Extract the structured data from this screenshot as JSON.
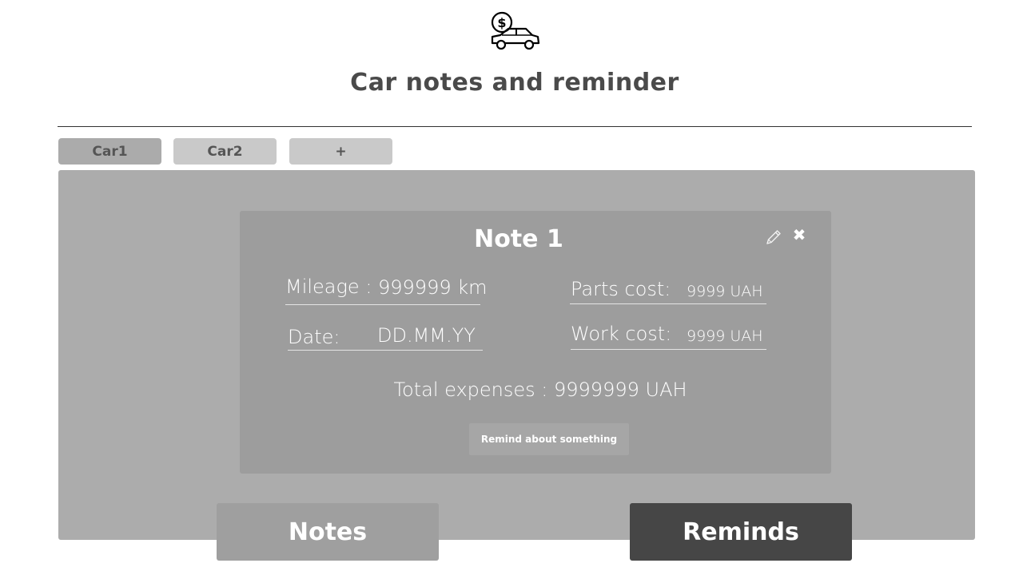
{
  "app": {
    "title": "Car notes and reminder",
    "logo_icon": "car-dollar-icon"
  },
  "car_tabs": [
    {
      "label": "Car1",
      "active": true
    },
    {
      "label": "Car2",
      "active": false
    },
    {
      "label": "+",
      "active": false
    }
  ],
  "note": {
    "title": "Note 1",
    "edit_icon": "pencil-icon",
    "close_icon": "close-icon",
    "mileage_label": "Mileage :",
    "mileage_value": "999999 km",
    "date_label": "Date:",
    "date_value": "DD.MM.YY",
    "parts_cost_label": "Parts cost:",
    "parts_cost_value": "9999 UAH",
    "work_cost_label": "Work cost:",
    "work_cost_value": "9999 UAH",
    "total_expenses": "Total expenses : 9999999 UAH",
    "remind_button": "Remind about something"
  },
  "bottom_nav": {
    "notes_label": "Notes",
    "reminds_label": "Reminds"
  },
  "colors": {
    "panel": "#acacac",
    "card": "#9d9d9d",
    "tab_active": "#ababab",
    "tab_inactive": "#c9c9c9",
    "notes_button": "#9f9f9f",
    "reminds_button": "#464646"
  }
}
